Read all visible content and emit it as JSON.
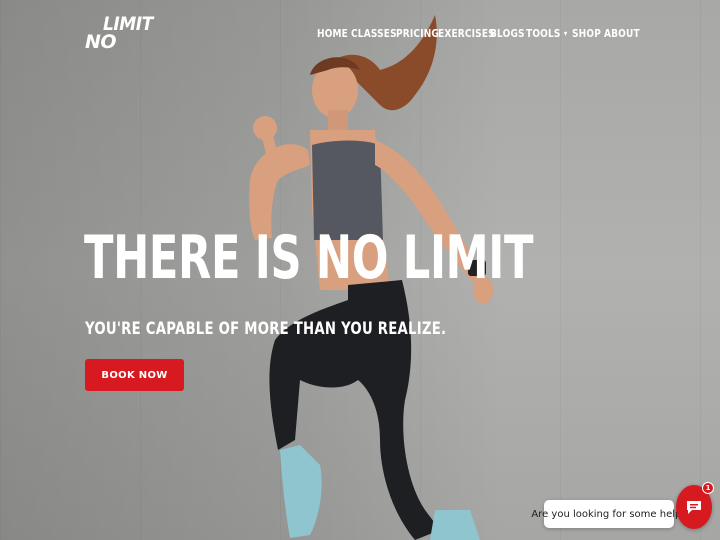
{
  "brand": {
    "logo_line1": "LIMIT",
    "logo_line2": "NO"
  },
  "nav": {
    "items": [
      "HOME",
      "CLASSES",
      "PRICING",
      "EXERCISES",
      "BLOGS",
      "TOOLS",
      "SHOP",
      "ABOUT"
    ],
    "dropdown_caret": "▾"
  },
  "hero": {
    "headline": "THERE IS NO LIMIT",
    "subheadline": "YOU'RE CAPABLE OF MORE THAN YOU REALIZE.",
    "cta_label": "BOOK NOW"
  },
  "chat": {
    "prompt": "Are you looking for some help?",
    "badge_count": "1",
    "icon": "chat-icon"
  },
  "colors": {
    "accent": "#d71920",
    "text": "#ffffff",
    "background": "#a9a9a7"
  }
}
